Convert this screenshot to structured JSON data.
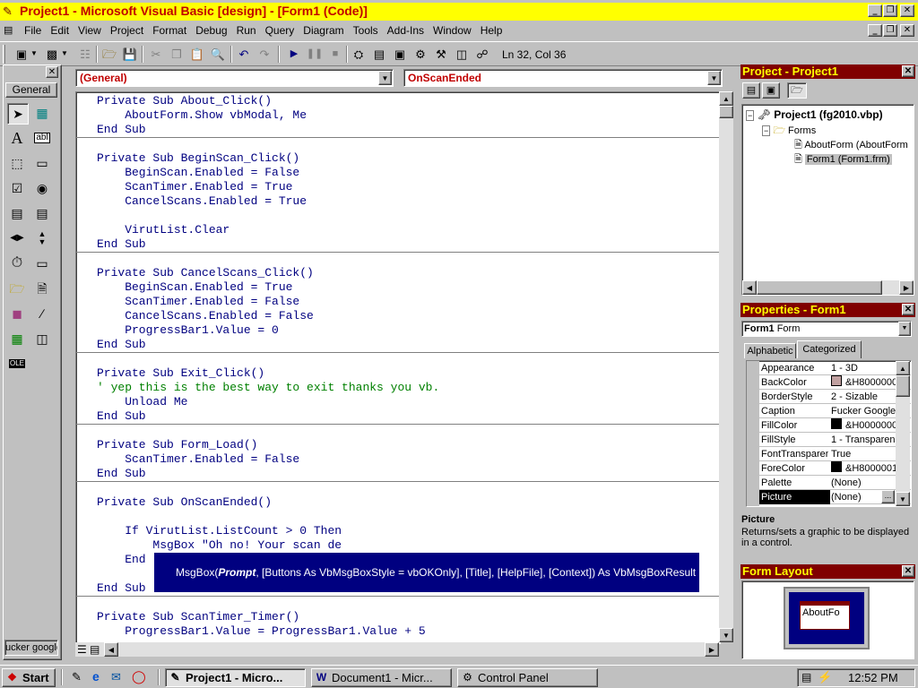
{
  "window": {
    "title": "Project1 - Microsoft Visual Basic [design] - [Form1 (Code)]",
    "minimize": "_",
    "restore": "❐",
    "close": "✕"
  },
  "menu": {
    "items": [
      {
        "label": "File"
      },
      {
        "label": "Edit"
      },
      {
        "label": "View"
      },
      {
        "label": "Project"
      },
      {
        "label": "Format"
      },
      {
        "label": "Debug"
      },
      {
        "label": "Run"
      },
      {
        "label": "Query"
      },
      {
        "label": "Diagram"
      },
      {
        "label": "Tools"
      },
      {
        "label": "Add-Ins"
      },
      {
        "label": "Window"
      },
      {
        "label": "Help"
      }
    ],
    "mdi_minimize": "_",
    "mdi_restore": "❐",
    "mdi_close": "✕"
  },
  "toolbar": {
    "position": "Ln 32, Col 36"
  },
  "toolbox": {
    "tab_label": "General",
    "bottom_label": "ucker google"
  },
  "code_window": {
    "object_combo": "(General)",
    "procedure_combo": "OnScanEnded",
    "lines": [
      {
        "text": "Private Sub About_Click()"
      },
      {
        "text": "    AboutForm.Show vbModal, Me"
      },
      {
        "text": "End Sub"
      },
      {
        "text": "Private Sub BeginScan_Click()"
      },
      {
        "text": "    BeginScan.Enabled = False"
      },
      {
        "text": "    ScanTimer.Enabled = True"
      },
      {
        "text": "    CancelScans.Enabled = True"
      },
      {
        "text": "    VirutList.Clear"
      },
      {
        "text": "End Sub"
      },
      {
        "text": "Private Sub CancelScans_Click()"
      },
      {
        "text": "    BeginScan.Enabled = True"
      },
      {
        "text": "    ScanTimer.Enabled = False"
      },
      {
        "text": "    CancelScans.Enabled = False"
      },
      {
        "text": "    ProgressBar1.Value = 0"
      },
      {
        "text": "End Sub"
      },
      {
        "text": "Private Sub Exit_Click()"
      },
      {
        "text": "' yep this is the best way to exit thanks you vb."
      },
      {
        "text": "    Unload Me"
      },
      {
        "text": "End Sub"
      },
      {
        "text": "Private Sub Form_Load()"
      },
      {
        "text": "    ScanTimer.Enabled = False"
      },
      {
        "text": "End Sub"
      },
      {
        "text": "Private Sub OnScanEnded()"
      },
      {
        "text": "    If VirutList.ListCount > 0 Then"
      },
      {
        "text": "        MsgBox \"Oh no! Your scan de"
      },
      {
        "text": "    End"
      },
      {
        "text": "End Sub"
      },
      {
        "text": "Private Sub ScanTimer_Timer()"
      },
      {
        "text": "    ProgressBar1.Value = ProgressBar1.Value + 5"
      }
    ],
    "tooltip": {
      "fn": "MsgBox(",
      "prompt": "Prompt",
      "rest": ", [Buttons As VbMsgBoxStyle = vbOKOnly], [Title], [HelpFile], [Context]) As VbMsgBoxResult"
    }
  },
  "project": {
    "title": "Project - Project1",
    "root": "Project1 (fg2010.vbp)",
    "folder": "Forms",
    "items": [
      {
        "label": "AboutForm (AboutForm"
      },
      {
        "label": "Form1 (Form1.frm)"
      }
    ]
  },
  "properties": {
    "title": "Properties - Form1",
    "object": "Form1",
    "object_type": "Form",
    "tabs": [
      {
        "label": "Alphabetic"
      },
      {
        "label": "Categorized"
      }
    ],
    "rows": [
      {
        "name": "Appearance",
        "value": "1 - 3D"
      },
      {
        "name": "BackColor",
        "value": "&H8000000",
        "swatch": "#c0a0a0"
      },
      {
        "name": "BorderStyle",
        "value": "2 - Sizable"
      },
      {
        "name": "Caption",
        "value": "Fucker Google"
      },
      {
        "name": "FillColor",
        "value": "&H0000000",
        "swatch": "#000000"
      },
      {
        "name": "FillStyle",
        "value": "1 - Transparen"
      },
      {
        "name": "FontTransparen",
        "value": "True"
      },
      {
        "name": "ForeColor",
        "value": "&H8000001",
        "swatch": "#000000"
      },
      {
        "name": "Palette",
        "value": "(None)"
      },
      {
        "name": "Picture",
        "value": "(None)"
      }
    ],
    "ellipsis": "...",
    "desc_title": "Picture",
    "desc_text": "Returns/sets a graphic to be displayed in a control."
  },
  "form_layout": {
    "title": "Form Layout",
    "form_label": "AboutFo"
  },
  "taskbar": {
    "start": "Start",
    "tasks": [
      {
        "label": "Project1 - Micro..."
      },
      {
        "label": "Document1 - Micr..."
      },
      {
        "label": "Control Panel"
      }
    ],
    "clock": "12:52 PM"
  }
}
